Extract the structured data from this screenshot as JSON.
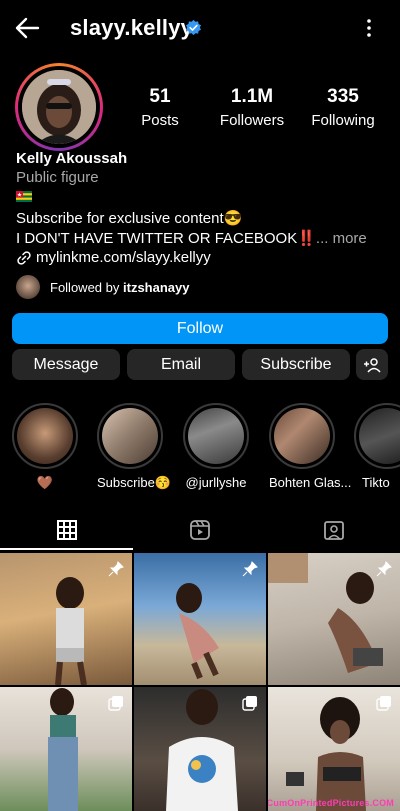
{
  "header": {
    "username": "slayy.kellyy",
    "back_icon": "arrow-left-icon",
    "verified_icon": "verified-badge-icon",
    "menu_icon": "more-vertical-icon",
    "verified_color": "#3897f0"
  },
  "profile": {
    "stats": [
      {
        "value": "51",
        "label": "Posts"
      },
      {
        "value": "1.1M",
        "label": "Followers"
      },
      {
        "value": "335",
        "label": "Following"
      }
    ],
    "full_name": "Kelly Akoussah",
    "category": "Public figure",
    "bio_line1": "Subscribe for exclusive content😎",
    "bio_line2": "I DON'T HAVE TWITTER OR FACEBOOK‼️",
    "bio_more": "... more",
    "link": "mylinkme.com/slayy.kellyy",
    "followed_by_prefix": "Followed by",
    "followed_by_user": "itzshanayy"
  },
  "actions": {
    "follow": "Follow",
    "message": "Message",
    "email": "Email",
    "subscribe": "Subscribe",
    "add_user_icon": "add-user-icon",
    "follow_color": "#0095f6"
  },
  "highlights": [
    {
      "label": "🤎"
    },
    {
      "label": "Subscribe😚"
    },
    {
      "label": "@jurllyshe"
    },
    {
      "label": "Bohten Glas..."
    },
    {
      "label": "Tikto"
    }
  ],
  "tabs": [
    {
      "name": "grid",
      "icon": "grid-icon"
    },
    {
      "name": "reels",
      "icon": "reels-icon"
    },
    {
      "name": "tagged",
      "icon": "tagged-icon"
    }
  ],
  "watermark": "CumOnPrintedPictures.COM"
}
